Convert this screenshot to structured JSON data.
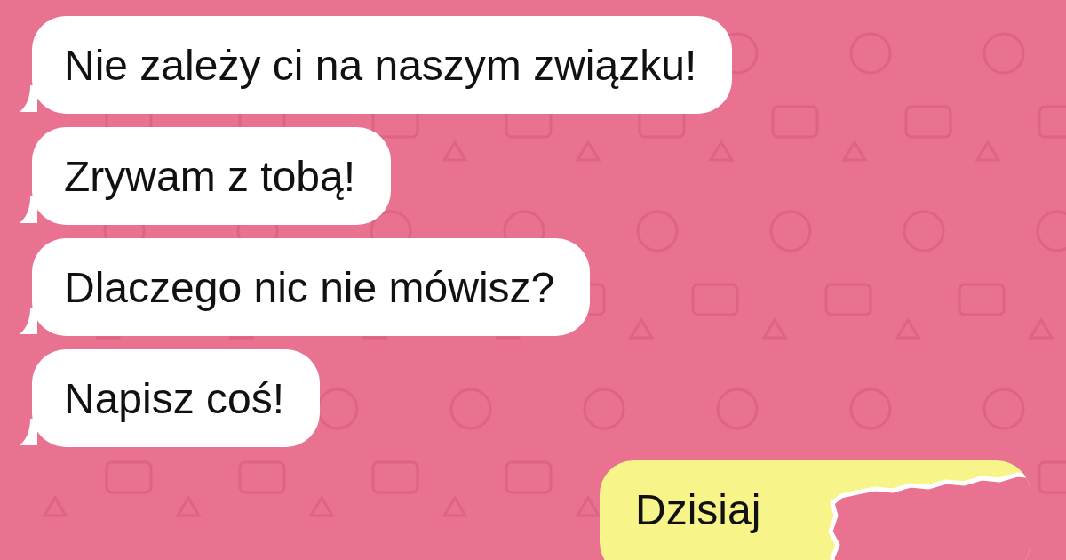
{
  "messages": [
    {
      "kind": "incoming",
      "text": "Nie zależy ci na naszym związku!"
    },
    {
      "kind": "incoming",
      "text": "Zrywam z tobą!"
    },
    {
      "kind": "incoming",
      "text": "Dlaczego nic nie mówisz?"
    },
    {
      "kind": "incoming",
      "text": "Napisz coś!"
    },
    {
      "kind": "outgoing",
      "text": "Dzisiaj",
      "torn": true
    }
  ]
}
